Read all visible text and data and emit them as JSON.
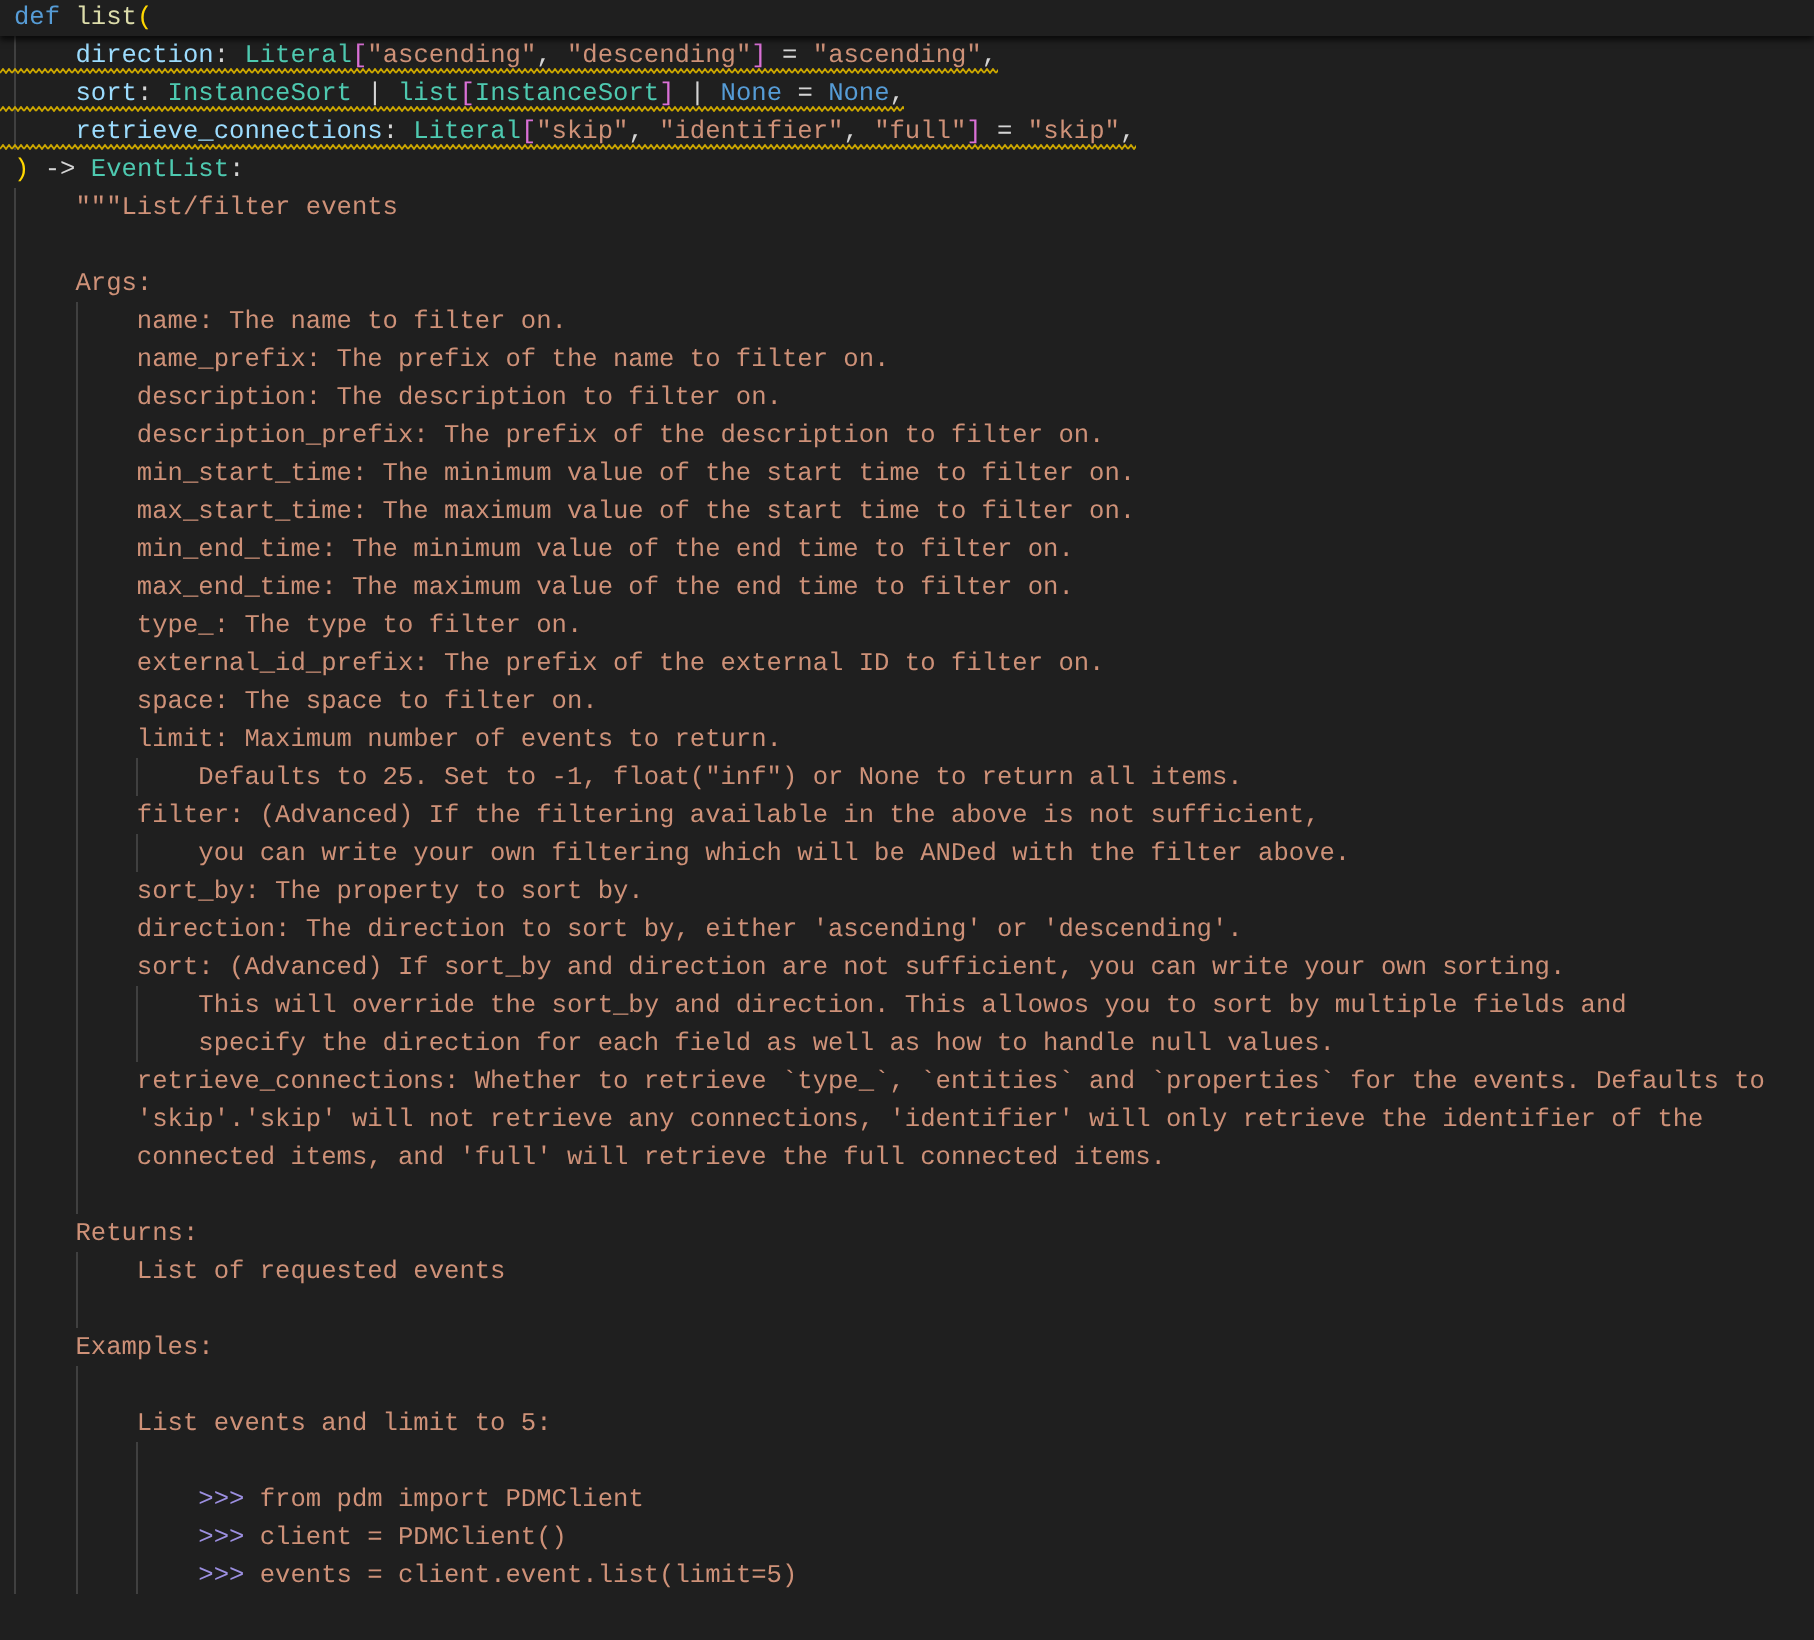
{
  "sticky_header": {
    "tokens": [
      {
        "kind": "keyword",
        "text": "def "
      },
      {
        "kind": "function",
        "text": "list"
      },
      {
        "kind": "paren",
        "text": "("
      }
    ]
  },
  "lines": [
    {
      "warning": true,
      "tokens": [
        {
          "kind": "param",
          "text": "    direction"
        },
        {
          "kind": "plain",
          "text": ": "
        },
        {
          "kind": "type",
          "text": "Literal"
        },
        {
          "kind": "bracket",
          "text": "["
        },
        {
          "kind": "string",
          "text": "\"ascending\""
        },
        {
          "kind": "plain",
          "text": ", "
        },
        {
          "kind": "string",
          "text": "\"descending\""
        },
        {
          "kind": "bracket",
          "text": "]"
        },
        {
          "kind": "plain",
          "text": " = "
        },
        {
          "kind": "string",
          "text": "\"ascending\""
        },
        {
          "kind": "plain",
          "text": ","
        }
      ]
    },
    {
      "warning": true,
      "tokens": [
        {
          "kind": "param",
          "text": "    sort"
        },
        {
          "kind": "plain",
          "text": ": "
        },
        {
          "kind": "type",
          "text": "InstanceSort"
        },
        {
          "kind": "plain",
          "text": " | "
        },
        {
          "kind": "type",
          "text": "list"
        },
        {
          "kind": "bracket",
          "text": "["
        },
        {
          "kind": "type",
          "text": "InstanceSort"
        },
        {
          "kind": "bracket",
          "text": "]"
        },
        {
          "kind": "plain",
          "text": " | "
        },
        {
          "kind": "constant",
          "text": "None"
        },
        {
          "kind": "plain",
          "text": " = "
        },
        {
          "kind": "constant",
          "text": "None"
        },
        {
          "kind": "plain",
          "text": ","
        }
      ]
    },
    {
      "warning": true,
      "tokens": [
        {
          "kind": "param",
          "text": "    retrieve_connections"
        },
        {
          "kind": "plain",
          "text": ": "
        },
        {
          "kind": "type",
          "text": "Literal"
        },
        {
          "kind": "bracket",
          "text": "["
        },
        {
          "kind": "string",
          "text": "\"skip\""
        },
        {
          "kind": "plain",
          "text": ", "
        },
        {
          "kind": "string",
          "text": "\"identifier\""
        },
        {
          "kind": "plain",
          "text": ", "
        },
        {
          "kind": "string",
          "text": "\"full\""
        },
        {
          "kind": "bracket",
          "text": "]"
        },
        {
          "kind": "plain",
          "text": " = "
        },
        {
          "kind": "string",
          "text": "\"skip\""
        },
        {
          "kind": "plain",
          "text": ","
        }
      ]
    },
    {
      "warning": false,
      "tokens": [
        {
          "kind": "paren",
          "text": ")"
        },
        {
          "kind": "plain",
          "text": " -> "
        },
        {
          "kind": "type",
          "text": "EventList"
        },
        {
          "kind": "plain",
          "text": ":"
        }
      ]
    },
    {
      "warning": false,
      "tokens": [
        {
          "kind": "string",
          "text": "    \"\"\"List/filter events"
        }
      ]
    },
    {
      "kind": "blank"
    },
    {
      "warning": false,
      "tokens": [
        {
          "kind": "string",
          "text": "    Args:"
        }
      ]
    },
    {
      "warning": false,
      "tokens": [
        {
          "kind": "string",
          "text": "        name: The name to filter on."
        }
      ]
    },
    {
      "warning": false,
      "tokens": [
        {
          "kind": "string",
          "text": "        name_prefix: The prefix of the name to filter on."
        }
      ]
    },
    {
      "warning": false,
      "tokens": [
        {
          "kind": "string",
          "text": "        description: The description to filter on."
        }
      ]
    },
    {
      "warning": false,
      "tokens": [
        {
          "kind": "string",
          "text": "        description_prefix: The prefix of the description to filter on."
        }
      ]
    },
    {
      "warning": false,
      "tokens": [
        {
          "kind": "string",
          "text": "        min_start_time: The minimum value of the start time to filter on."
        }
      ]
    },
    {
      "warning": false,
      "tokens": [
        {
          "kind": "string",
          "text": "        max_start_time: The maximum value of the start time to filter on."
        }
      ]
    },
    {
      "warning": false,
      "tokens": [
        {
          "kind": "string",
          "text": "        min_end_time: The minimum value of the end time to filter on."
        }
      ]
    },
    {
      "warning": false,
      "tokens": [
        {
          "kind": "string",
          "text": "        max_end_time: The maximum value of the end time to filter on."
        }
      ]
    },
    {
      "warning": false,
      "tokens": [
        {
          "kind": "string",
          "text": "        type_: The type to filter on."
        }
      ]
    },
    {
      "warning": false,
      "tokens": [
        {
          "kind": "string",
          "text": "        external_id_prefix: The prefix of the external ID to filter on."
        }
      ]
    },
    {
      "warning": false,
      "tokens": [
        {
          "kind": "string",
          "text": "        space: The space to filter on."
        }
      ]
    },
    {
      "warning": false,
      "tokens": [
        {
          "kind": "string",
          "text": "        limit: Maximum number of events to return."
        }
      ]
    },
    {
      "warning": false,
      "tokens": [
        {
          "kind": "string",
          "text": "            Defaults to 25. Set to -1, float(\"inf\") or None to return all items."
        }
      ]
    },
    {
      "warning": false,
      "tokens": [
        {
          "kind": "string",
          "text": "        filter: (Advanced) If the filtering available in the above is not sufficient,"
        }
      ]
    },
    {
      "warning": false,
      "tokens": [
        {
          "kind": "string",
          "text": "            you can write your own filtering which will be ANDed with the filter above."
        }
      ]
    },
    {
      "warning": false,
      "tokens": [
        {
          "kind": "string",
          "text": "        sort_by: The property to sort by."
        }
      ]
    },
    {
      "warning": false,
      "tokens": [
        {
          "kind": "string",
          "text": "        direction: The direction to sort by, either 'ascending' or 'descending'."
        }
      ]
    },
    {
      "warning": false,
      "tokens": [
        {
          "kind": "string",
          "text": "        sort: (Advanced) If sort_by and direction are not sufficient, you can write your own sorting."
        }
      ]
    },
    {
      "warning": false,
      "tokens": [
        {
          "kind": "string",
          "text": "            This will override the sort_by and direction. This allowos you to sort by multiple fields and"
        }
      ]
    },
    {
      "warning": false,
      "tokens": [
        {
          "kind": "string",
          "text": "            specify the direction for each field as well as how to handle null values."
        }
      ]
    },
    {
      "warning": false,
      "tokens": [
        {
          "kind": "string",
          "text": "        retrieve_connections: Whether to retrieve `type_`, `entities` and `properties` for the events. Defaults to"
        }
      ]
    },
    {
      "warning": false,
      "tokens": [
        {
          "kind": "string",
          "text": "        'skip'.'skip' will not retrieve any connections, 'identifier' will only retrieve the identifier of the"
        }
      ]
    },
    {
      "warning": false,
      "tokens": [
        {
          "kind": "string",
          "text": "        connected items, and 'full' will retrieve the full connected items."
        }
      ]
    },
    {
      "kind": "blank"
    },
    {
      "warning": false,
      "tokens": [
        {
          "kind": "string",
          "text": "    Returns:"
        }
      ]
    },
    {
      "warning": false,
      "tokens": [
        {
          "kind": "string",
          "text": "        List of requested events"
        }
      ]
    },
    {
      "kind": "blank"
    },
    {
      "warning": false,
      "tokens": [
        {
          "kind": "string",
          "text": "    Examples:"
        }
      ]
    },
    {
      "kind": "blank"
    },
    {
      "warning": false,
      "tokens": [
        {
          "kind": "string",
          "text": "        List events and limit to 5:"
        }
      ]
    },
    {
      "kind": "blank"
    },
    {
      "warning": false,
      "tokens": [
        {
          "kind": "prompt",
          "text": "            >>>"
        },
        {
          "kind": "string",
          "text": " from pdm import PDMClient"
        }
      ]
    },
    {
      "warning": false,
      "tokens": [
        {
          "kind": "prompt",
          "text": "            >>>"
        },
        {
          "kind": "string",
          "text": " client = PDMClient()"
        }
      ]
    },
    {
      "warning": false,
      "tokens": [
        {
          "kind": "prompt",
          "text": "            >>>"
        },
        {
          "kind": "string",
          "text": " events = client.event.list(limit=5)"
        }
      ]
    }
  ]
}
